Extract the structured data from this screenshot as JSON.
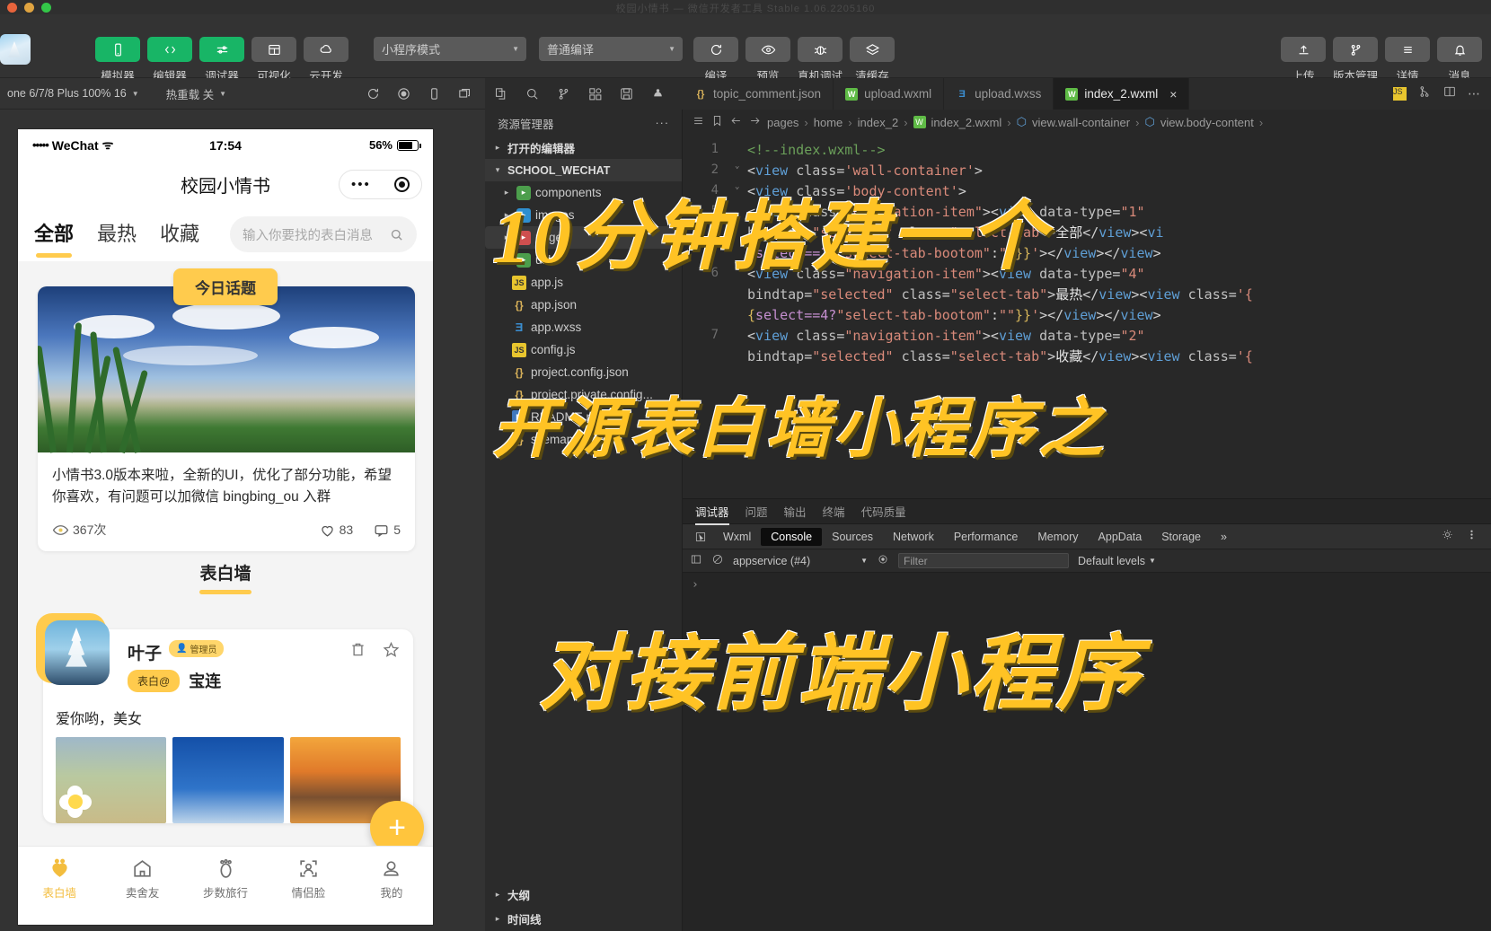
{
  "window": {
    "title": "校园小情书 — 微信开发者工具 Stable 1.06.2205160"
  },
  "toolbar": {
    "mode_select": "小程序模式",
    "compile_select": "普通编译",
    "left_buttons": [
      {
        "label": "模拟器",
        "icon": "phone-icon",
        "style": "green"
      },
      {
        "label": "编辑器",
        "icon": "code-icon",
        "style": "green"
      },
      {
        "label": "调试器",
        "icon": "sliders-icon",
        "style": "green"
      },
      {
        "label": "可视化",
        "icon": "layout-icon",
        "style": "grey"
      },
      {
        "label": "云开发",
        "icon": "cloud-icon",
        "style": "grey"
      }
    ],
    "mid_buttons": [
      {
        "label": "编译",
        "icon": "refresh-icon"
      },
      {
        "label": "预览",
        "icon": "eye-icon"
      },
      {
        "label": "真机调试",
        "icon": "bug-icon"
      },
      {
        "label": "清缓存",
        "icon": "layers-icon"
      }
    ],
    "right_buttons": [
      {
        "label": "上传",
        "icon": "upload-icon"
      },
      {
        "label": "版本管理",
        "icon": "branch-icon"
      },
      {
        "label": "详情",
        "icon": "menu-icon"
      },
      {
        "label": "消息",
        "icon": "bell-icon"
      }
    ]
  },
  "simulator_bar": {
    "device": "one 6/7/8 Plus 100% 16",
    "hot_reload": "热重载 关",
    "icons": [
      "refresh-icon",
      "record-icon",
      "device-icon",
      "multi-window-icon"
    ]
  },
  "editor_bar": {
    "icons": [
      "explorer-icon",
      "search-icon",
      "source-control-icon",
      "extensions-icon",
      "save-icon",
      "debug-icon"
    ]
  },
  "tabs": [
    {
      "label": "topic_comment.json",
      "type": "json",
      "active": false
    },
    {
      "label": "upload.wxml",
      "type": "wxml",
      "active": false
    },
    {
      "label": "upload.wxss",
      "type": "wxss",
      "active": false
    },
    {
      "label": "index_2.wxml",
      "type": "wxml",
      "active": true,
      "close": "×"
    }
  ],
  "tab_tools": [
    "js-icon",
    "split-branch-icon",
    "split-editor-icon",
    "more-icon"
  ],
  "explorer": {
    "header": "资源管理器",
    "header_more": "···",
    "open_editors": "打开的编辑器",
    "project_root": "SCHOOL_WECHAT",
    "items": [
      {
        "label": "components",
        "icon": "folder-icon",
        "caret": "▸",
        "depth": 1
      },
      {
        "label": "images",
        "icon": "folder-img-icon",
        "caret": "▸",
        "depth": 1
      },
      {
        "label": "pages",
        "icon": "folder-pages-icon",
        "caret": "▸",
        "depth": 1,
        "selected": true
      },
      {
        "label": "utils",
        "icon": "folder-icon",
        "caret": "▸",
        "depth": 1
      },
      {
        "label": "app.js",
        "icon": "js-icon",
        "caret": "",
        "depth": 1
      },
      {
        "label": "app.json",
        "icon": "json-icon",
        "caret": "",
        "depth": 1
      },
      {
        "label": "app.wxss",
        "icon": "wxss-icon",
        "caret": "",
        "depth": 1
      },
      {
        "label": "config.js",
        "icon": "js-icon",
        "caret": "",
        "depth": 1
      },
      {
        "label": "project.config.json",
        "icon": "json-icon",
        "caret": "",
        "depth": 1
      },
      {
        "label": "project.private.config...",
        "icon": "json-icon",
        "caret": "",
        "depth": 1
      },
      {
        "label": "README.md",
        "icon": "md-icon",
        "caret": "",
        "depth": 1
      },
      {
        "label": "sitemap.json",
        "icon": "json-icon",
        "caret": "",
        "depth": 1
      }
    ],
    "bottom_sections": [
      {
        "label": "大纲",
        "caret": "▸"
      },
      {
        "label": "时间线",
        "caret": "▸"
      }
    ]
  },
  "breadcrumb": {
    "items": [
      "pages",
      "home",
      "index_2",
      "index_2.wxml",
      "view.wall-container",
      "view.body-content"
    ],
    "sep": "›"
  },
  "code_lines": [
    {
      "num": "1",
      "fold": "",
      "html": "<span class='c-com'>&lt;!--index.wxml--&gt;</span>"
    },
    {
      "num": "2",
      "fold": "⌄",
      "html": "<span class='c-pun'>&lt;</span><span class='c-tag'>view</span> <span class='c-attr'>class</span><span class='c-pun'>=</span><span class='c-str'>'wall-container'</span><span class='c-pun'>&gt;</span>"
    },
    {
      "num": "4",
      "fold": "⌄",
      "html": "<span class='c-pun'>&lt;</span><span class='c-tag'>view</span> <span class='c-attr'>class</span><span class='c-pun'>=</span><span class='c-str'>'body-content'</span><span class='c-pun'>&gt;</span>"
    },
    {
      "num": "5",
      "fold": "",
      "html": "<span class='c-pun'>&lt;</span><span class='c-tag'>view</span> <span class='c-attr'>class</span><span class='c-pun'>=</span><span class='c-str'>\"navigation-item\"</span><span class='c-pun'>&gt;&lt;</span><span class='c-tag'>view</span> <span class='c-attr'>data-type</span><span class='c-pun'>=</span><span class='c-str'>\"1\"</span>"
    },
    {
      "num": "",
      "fold": "",
      "html": "<span class='c-attr'>bindtap</span><span class='c-pun'>=</span><span class='c-str'>\"selected\"</span> <span class='c-attr'>class</span><span class='c-pun'>=</span><span class='c-str'>\"select-tab\"</span><span class='c-pun'>&gt;</span><span class='c-txt'>全部</span><span class='c-pun'>&lt;/</span><span class='c-tag'>view</span><span class='c-pun'>&gt;&lt;</span><span class='c-tag'>vi</span>"
    },
    {
      "num": "",
      "fold": "",
      "html": "<span class='c-brace'>{</span><span class='c-expr'>select==1?</span><span class='c-str'>\"select-tab-bootom\"</span><span class='c-pun'>:</span><span class='c-str'>\"\"</span><span class='c-brace'>}}</span><span class='c-str'>'</span><span class='c-pun'>&gt;&lt;/</span><span class='c-tag'>view</span><span class='c-pun'>&gt;&lt;/</span><span class='c-tag'>view</span><span class='c-pun'>&gt;</span>"
    },
    {
      "num": "6",
      "fold": "",
      "html": "<span class='c-pun'>&lt;</span><span class='c-tag'>view</span> <span class='c-attr'>class</span><span class='c-pun'>=</span><span class='c-str'>\"navigation-item\"</span><span class='c-pun'>&gt;&lt;</span><span class='c-tag'>view</span> <span class='c-attr'>data-type</span><span class='c-pun'>=</span><span class='c-str'>\"4\"</span>"
    },
    {
      "num": "",
      "fold": "",
      "html": "<span class='c-attr'>bindtap</span><span class='c-pun'>=</span><span class='c-str'>\"selected\"</span> <span class='c-attr'>class</span><span class='c-pun'>=</span><span class='c-str'>\"select-tab\"</span><span class='c-pun'>&gt;</span><span class='c-txt'>最热</span><span class='c-pun'>&lt;/</span><span class='c-tag'>view</span><span class='c-pun'>&gt;&lt;</span><span class='c-tag'>view</span> <span class='c-attr'>class</span><span class='c-pun'>=</span><span class='c-str'>'{</span>"
    },
    {
      "num": "",
      "fold": "",
      "html": "<span class='c-brace'>{</span><span class='c-expr'>select==4?</span><span class='c-str'>\"select-tab-bootom\"</span><span class='c-pun'>:</span><span class='c-str'>\"\"</span><span class='c-brace'>}}</span><span class='c-str'>'</span><span class='c-pun'>&gt;&lt;/</span><span class='c-tag'>view</span><span class='c-pun'>&gt;&lt;/</span><span class='c-tag'>view</span><span class='c-pun'>&gt;</span>"
    },
    {
      "num": "7",
      "fold": "",
      "html": "<span class='c-pun'>&lt;</span><span class='c-tag'>view</span> <span class='c-attr'>class</span><span class='c-pun'>=</span><span class='c-str'>\"navigation-item\"</span><span class='c-pun'>&gt;&lt;</span><span class='c-tag'>view</span> <span class='c-attr'>data-type</span><span class='c-pun'>=</span><span class='c-str'>\"2\"</span>"
    },
    {
      "num": "",
      "fold": "",
      "html": "<span class='c-attr'>bindtap</span><span class='c-pun'>=</span><span class='c-str'>\"selected\"</span> <span class='c-attr'>class</span><span class='c-pun'>=</span><span class='c-str'>\"select-tab\"</span><span class='c-pun'>&gt;</span><span class='c-txt'>收藏</span><span class='c-pun'>&lt;/</span><span class='c-tag'>view</span><span class='c-pun'>&gt;&lt;</span><span class='c-tag'>view</span> <span class='c-attr'>class</span><span class='c-pun'>=</span><span class='c-str'>'{</span>"
    }
  ],
  "debugger": {
    "panel_tabs": [
      {
        "label": "调试器",
        "active": true
      },
      {
        "label": "问题",
        "active": false
      },
      {
        "label": "输出",
        "active": false
      },
      {
        "label": "终端",
        "active": false
      },
      {
        "label": "代码质量",
        "active": false
      }
    ],
    "devtool_tabs": [
      {
        "label": "Wxml",
        "active": false
      },
      {
        "label": "Console",
        "active": true
      },
      {
        "label": "Sources",
        "active": false
      },
      {
        "label": "Network",
        "active": false
      },
      {
        "label": "Performance",
        "active": false
      },
      {
        "label": "Memory",
        "active": false
      },
      {
        "label": "AppData",
        "active": false
      },
      {
        "label": "Storage",
        "active": false
      }
    ],
    "overflow": "»",
    "context": "appservice (#4)",
    "filter_placeholder": "Filter",
    "levels": "Default levels",
    "prompt": "›"
  },
  "simulator": {
    "status": {
      "carrier": "WeChat",
      "dots": "•••••",
      "time": "17:54",
      "battery": "56%"
    },
    "nav_title": "校园小情书",
    "tabs": [
      {
        "label": "全部",
        "active": true
      },
      {
        "label": "最热",
        "active": false
      },
      {
        "label": "收藏",
        "active": false
      }
    ],
    "search_placeholder": "输入你要找的表白消息",
    "topic_badge": "今日话题",
    "announcement": {
      "text": "小情书3.0版本来啦，全新的UI，优化了部分功能，希望你喜欢，有问题可以加微信 bingbing_ou 入群",
      "views": "367次",
      "likes": "83",
      "comments": "5"
    },
    "section_title": "表白墙",
    "post": {
      "name": "叶子",
      "admin_badge": "管理员",
      "type_badge": "表白@",
      "target": "宝连",
      "message": "爱你哟，美女",
      "actions": [
        "trash-icon",
        "star-icon"
      ]
    },
    "fab": "+",
    "tabbar": [
      {
        "label": "表白墙",
        "icon": "heart-icon",
        "active": true
      },
      {
        "label": "卖舍友",
        "icon": "house-icon",
        "active": false
      },
      {
        "label": "步数旅行",
        "icon": "footprint-icon",
        "active": false
      },
      {
        "label": "情侣脸",
        "icon": "face-scan-icon",
        "active": false
      },
      {
        "label": "我的",
        "icon": "person-icon",
        "active": false
      }
    ]
  },
  "overlay": {
    "line1": "10分钟搭建一个",
    "line2": "开源表白墙小程序之",
    "line3": "对接前端小程序"
  },
  "colors": {
    "accent_yellow": "#ffc324",
    "brand_green": "#18b566",
    "app_yellow": "#ffcb4d"
  }
}
